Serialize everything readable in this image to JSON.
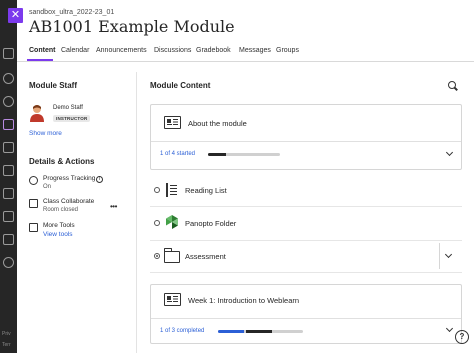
{
  "header": {
    "course_id": "sandbox_ultra_2022-23_01",
    "course_title": "AB1001 Example Module",
    "close_glyph": "✕"
  },
  "nav": {
    "footer_a": "Priv",
    "footer_b": "Terr",
    "icons": [
      "institution-icon",
      "profile-icon",
      "globe-icon",
      "courses-icon",
      "organizations-icon",
      "calendar-icon",
      "messages-icon",
      "grades-icon",
      "tools-icon",
      "signout-icon"
    ]
  },
  "tabs": [
    {
      "label": "Content",
      "active": true
    },
    {
      "label": "Calendar"
    },
    {
      "label": "Announcements"
    },
    {
      "label": "Discussions"
    },
    {
      "label": "Gradebook"
    },
    {
      "label": "Messages"
    },
    {
      "label": "Groups"
    }
  ],
  "sidebar": {
    "staff_heading": "Module Staff",
    "staff": {
      "name": "Demo Staff",
      "role": "INSTRUCTOR"
    },
    "show_more": "Show more",
    "details_heading": "Details & Actions",
    "actions": [
      {
        "title": "Progress Tracking",
        "sub": "On"
      },
      {
        "title": "Class Collaborate",
        "sub": "Room closed"
      },
      {
        "title": "More Tools",
        "sub": "View tools"
      }
    ]
  },
  "content": {
    "heading": "Module Content",
    "about": {
      "title": "About the module",
      "progress_text": "1 of 4 started",
      "progress": 0.25
    },
    "items": [
      {
        "title": "Reading List"
      },
      {
        "title": "Panopto Folder"
      },
      {
        "title": "Assessment"
      }
    ],
    "week1": {
      "title": "Week 1: Introduction to Weblearn",
      "progress_text": "1 of 3 completed",
      "progress": 0.33
    }
  },
  "colors": {
    "accent": "#7c3aed",
    "link": "#2b5fd6",
    "progress_blue": "#2b5fd6"
  },
  "help_glyph": "?"
}
